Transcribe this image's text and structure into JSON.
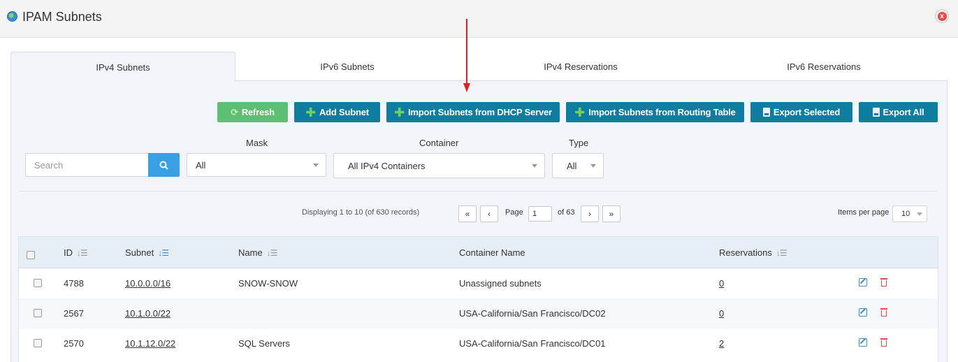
{
  "window": {
    "title": "IPAM Subnets",
    "close_label": "x"
  },
  "tabs": [
    {
      "label": "IPv4 Subnets",
      "active": true
    },
    {
      "label": "IPv6 Subnets",
      "active": false
    },
    {
      "label": "IPv4 Reservations",
      "active": false
    },
    {
      "label": "IPv6 Reservations",
      "active": false
    }
  ],
  "toolbar": {
    "refresh": "Refresh",
    "add_subnet": "Add Subnet",
    "import_dhcp": "Import Subnets from DHCP Server",
    "import_routing": "Import Subnets from Routing Table",
    "export_selected": "Export Selected",
    "export_all": "Export All"
  },
  "filters": {
    "search_placeholder": "Search",
    "mask_label": "Mask",
    "mask_value": "All",
    "container_label": "Container",
    "container_value": "All IPv4 Containers",
    "type_label": "Type",
    "type_value": "All"
  },
  "pagination": {
    "info": "Displaying 1 to 10 (of 630 records)",
    "first": "«",
    "prev": "‹",
    "page_label": "Page",
    "page_value": "1",
    "of_total": "of 63",
    "next": "›",
    "last": "»",
    "items_per_page_label": "Items per page",
    "items_per_page_value": "10"
  },
  "table": {
    "headers": {
      "id": "ID",
      "subnet": "Subnet",
      "name": "Name",
      "container": "Container Name",
      "reservations": "Reservations"
    },
    "rows": [
      {
        "id": "4788",
        "subnet": "10.0.0.0/16",
        "name": "SNOW-SNOW",
        "container": "Unassigned subnets",
        "reservations": "0"
      },
      {
        "id": "2567",
        "subnet": "10.1.0.0/22",
        "name": "",
        "container": "USA-California/San Francisco/DC02",
        "reservations": "0"
      },
      {
        "id": "2570",
        "subnet": "10.1.12.0/22",
        "name": "SQL Servers",
        "container": "USA-California/San Francisco/DC01",
        "reservations": "2"
      }
    ]
  },
  "colors": {
    "primary_button": "#0f7da0",
    "refresh_button": "#5cbf73",
    "search_button": "#3aa0e6",
    "annotation_arrow": "#e02020"
  }
}
